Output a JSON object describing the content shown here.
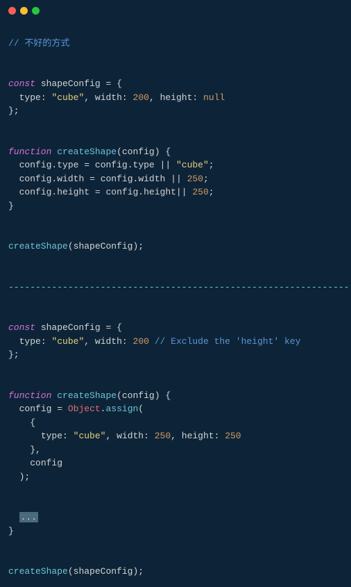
{
  "comments": {
    "badWay": "// 不好的方式",
    "excludeHeight": "// Exclude the 'height' key"
  },
  "strings": {
    "cube": "\"cube\""
  },
  "numbers": {
    "n200": "200",
    "n250": "250"
  },
  "keywords": {
    "const": "const",
    "function": "function",
    "null": "null"
  },
  "identifiers": {
    "shapeConfig": "shapeConfig",
    "createShape": "createShape",
    "config": "config",
    "type": "type",
    "width": "width",
    "height": "height",
    "Object": "Object",
    "assign": "assign"
  },
  "divider": "---------------------------------------------------------------",
  "dots": "..."
}
